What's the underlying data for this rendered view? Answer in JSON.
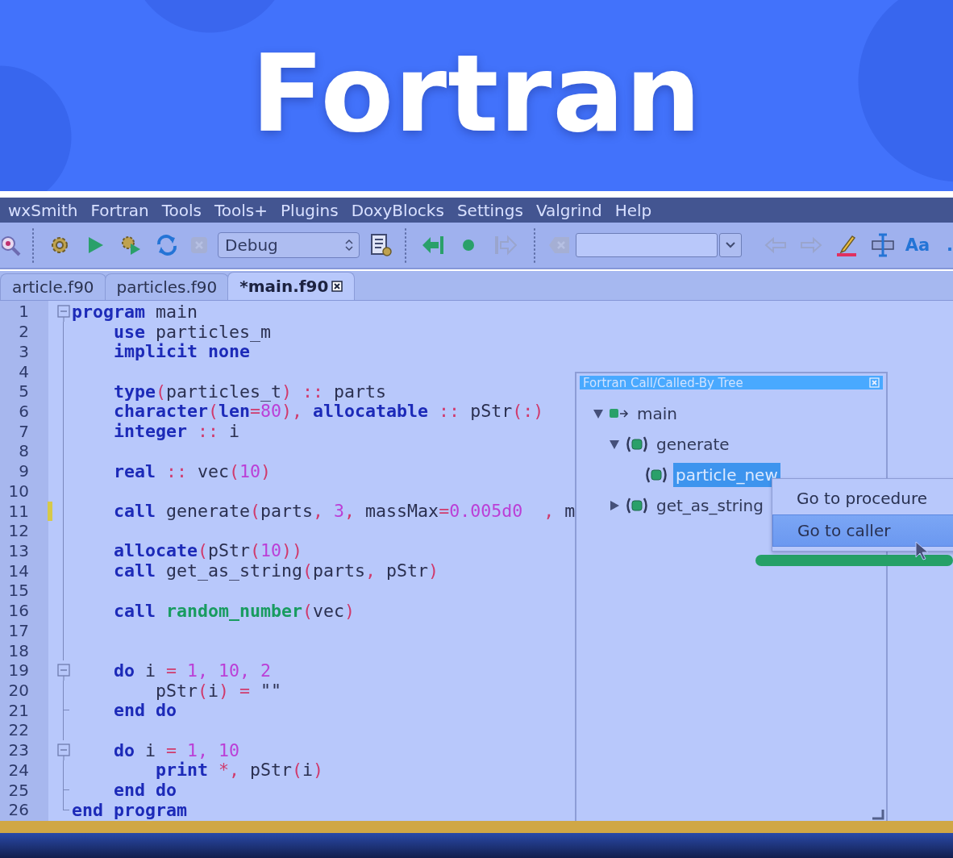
{
  "banner": {
    "title": "Fortran"
  },
  "menu": [
    {
      "label": "wxSmith"
    },
    {
      "label": "Fortran"
    },
    {
      "label": "Tools"
    },
    {
      "label": "Tools+"
    },
    {
      "label": "Plugins"
    },
    {
      "label": "DoxyBlocks"
    },
    {
      "label": "Settings"
    },
    {
      "label": "Valgrind"
    },
    {
      "label": "Help"
    }
  ],
  "toolbar": [
    {
      "kind": "find",
      "disabled": false
    },
    {
      "kind": "grip"
    },
    {
      "kind": "build",
      "disabled": false
    },
    {
      "kind": "run",
      "disabled": false
    },
    {
      "kind": "buildrun",
      "disabled": false
    },
    {
      "kind": "rebuild",
      "disabled": false
    },
    {
      "kind": "abort",
      "disabled": true
    },
    {
      "kind": "select",
      "value": "Debug"
    },
    {
      "kind": "targets",
      "disabled": false
    },
    {
      "kind": "grip"
    },
    {
      "kind": "stepin",
      "disabled": false
    },
    {
      "kind": "breakpoint",
      "disabled": false
    },
    {
      "kind": "stepout",
      "disabled": true
    },
    {
      "kind": "grip"
    },
    {
      "kind": "clear",
      "disabled": true
    },
    {
      "kind": "combo"
    },
    {
      "kind": "back",
      "disabled": true
    },
    {
      "kind": "forward",
      "disabled": true
    },
    {
      "kind": "highlight",
      "disabled": false
    },
    {
      "kind": "ruler",
      "disabled": false
    },
    {
      "kind": "text",
      "label": "Aa",
      "disabled": false
    },
    {
      "kind": "text",
      "label": ".",
      "disabled": false
    }
  ],
  "tabs": [
    {
      "label": "article.f90",
      "selected": false
    },
    {
      "label": "particles.f90",
      "selected": false
    },
    {
      "label": "*main.f90",
      "selected": true
    }
  ],
  "editor": {
    "lines": [
      {
        "number": "1",
        "kind": "fold-start",
        "changed": false,
        "tokens": [
          {
            "kind": "kw",
            "t": "program"
          },
          {
            "kind": "id",
            "t": " main"
          }
        ]
      },
      {
        "number": "2",
        "kind": "fold-line",
        "changed": false,
        "tokens": [
          {
            "kind": "kw",
            "t": "    use"
          },
          {
            "kind": "id",
            "t": " particles_m"
          }
        ]
      },
      {
        "number": "3",
        "kind": "fold-line",
        "changed": false,
        "tokens": [
          {
            "kind": "kw",
            "t": "    implicit none"
          }
        ]
      },
      {
        "number": "4",
        "kind": "fold-line",
        "changed": false
      },
      {
        "number": "5",
        "kind": "fold-line",
        "changed": false,
        "tokens": [
          {
            "kind": "kw",
            "t": "    type"
          },
          {
            "kind": "op",
            "t": "("
          },
          {
            "kind": "id",
            "t": "particles_t"
          },
          {
            "kind": "op",
            "t": ") ::"
          },
          {
            "kind": "id",
            "t": " parts"
          }
        ]
      },
      {
        "number": "6",
        "kind": "fold-line",
        "changed": false,
        "tokens": [
          {
            "kind": "kw",
            "t": "    character"
          },
          {
            "kind": "op",
            "t": "("
          },
          {
            "kind": "kw",
            "t": "len"
          },
          {
            "kind": "op",
            "t": "="
          },
          {
            "kind": "num",
            "t": "80"
          },
          {
            "kind": "op",
            "t": "), "
          },
          {
            "kind": "kw",
            "t": "allocatable"
          },
          {
            "kind": "op",
            "t": " ::"
          },
          {
            "kind": "id",
            "t": " pStr"
          },
          {
            "kind": "op",
            "t": "(:)"
          }
        ]
      },
      {
        "number": "7",
        "kind": "fold-line",
        "changed": false,
        "tokens": [
          {
            "kind": "kw",
            "t": "    integer"
          },
          {
            "kind": "op",
            "t": " ::"
          },
          {
            "kind": "id",
            "t": " i"
          }
        ]
      },
      {
        "number": "8",
        "kind": "fold-line",
        "changed": false
      },
      {
        "number": "9",
        "kind": "fold-line",
        "changed": false,
        "tokens": [
          {
            "kind": "kw",
            "t": "    real"
          },
          {
            "kind": "op",
            "t": " ::"
          },
          {
            "kind": "id",
            "t": " vec"
          },
          {
            "kind": "op",
            "t": "("
          },
          {
            "kind": "num",
            "t": "10"
          },
          {
            "kind": "op",
            "t": ")"
          }
        ]
      },
      {
        "number": "10",
        "kind": "fold-line",
        "changed": false
      },
      {
        "number": "11",
        "kind": "fold-line",
        "changed": true,
        "tokens": [
          {
            "kind": "kw",
            "t": "    call"
          },
          {
            "kind": "id",
            "t": " generate"
          },
          {
            "kind": "op",
            "t": "("
          },
          {
            "kind": "id",
            "t": "parts"
          },
          {
            "kind": "op",
            "t": ", "
          },
          {
            "kind": "num",
            "t": "3"
          },
          {
            "kind": "op",
            "t": ", "
          },
          {
            "kind": "id",
            "t": "massMax"
          },
          {
            "kind": "op",
            "t": "="
          },
          {
            "kind": "num",
            "t": "0.005d0"
          },
          {
            "kind": "op",
            "t": "  , "
          },
          {
            "kind": "id",
            "t": "m"
          }
        ]
      },
      {
        "number": "12",
        "kind": "fold-line",
        "changed": false
      },
      {
        "number": "13",
        "kind": "fold-line",
        "changed": false,
        "tokens": [
          {
            "kind": "kw",
            "t": "    allocate"
          },
          {
            "kind": "op",
            "t": "("
          },
          {
            "kind": "id",
            "t": "pStr"
          },
          {
            "kind": "op",
            "t": "("
          },
          {
            "kind": "num",
            "t": "10"
          },
          {
            "kind": "op",
            "t": "))"
          }
        ]
      },
      {
        "number": "14",
        "kind": "fold-line",
        "changed": false,
        "tokens": [
          {
            "kind": "kw",
            "t": "    call"
          },
          {
            "kind": "id",
            "t": " get_as_string"
          },
          {
            "kind": "op",
            "t": "("
          },
          {
            "kind": "id",
            "t": "parts"
          },
          {
            "kind": "op",
            "t": ", "
          },
          {
            "kind": "id",
            "t": "pStr"
          },
          {
            "kind": "op",
            "t": ")"
          }
        ]
      },
      {
        "number": "15",
        "kind": "fold-line",
        "changed": false
      },
      {
        "number": "16",
        "kind": "fold-line",
        "changed": false,
        "tokens": [
          {
            "kind": "kw",
            "t": "    call "
          },
          {
            "kind": "fn",
            "t": "random_number"
          },
          {
            "kind": "op",
            "t": "("
          },
          {
            "kind": "id",
            "t": "vec"
          },
          {
            "kind": "op",
            "t": ")"
          }
        ]
      },
      {
        "number": "17",
        "kind": "fold-line",
        "changed": false
      },
      {
        "number": "18",
        "kind": "fold-line",
        "changed": false
      },
      {
        "number": "19",
        "kind": "fold-start",
        "changed": false,
        "tokens": [
          {
            "kind": "kw",
            "t": "    do"
          },
          {
            "kind": "id",
            "t": " i "
          },
          {
            "kind": "op",
            "t": "="
          },
          {
            "kind": "num",
            "t": " 1, 10, 2"
          }
        ]
      },
      {
        "number": "20",
        "kind": "fold-line",
        "changed": false,
        "tokens": [
          {
            "kind": "id",
            "t": "        pStr"
          },
          {
            "kind": "op",
            "t": "("
          },
          {
            "kind": "id",
            "t": "i"
          },
          {
            "kind": "op",
            "t": ") ="
          },
          {
            "kind": "id",
            "t": " \"\""
          }
        ]
      },
      {
        "number": "21",
        "kind": "fold-tee",
        "changed": false,
        "tokens": [
          {
            "kind": "kw",
            "t": "    end do"
          }
        ]
      },
      {
        "number": "22",
        "kind": "fold-line",
        "changed": false
      },
      {
        "number": "23",
        "kind": "fold-start",
        "changed": false,
        "tokens": [
          {
            "kind": "kw",
            "t": "    do"
          },
          {
            "kind": "id",
            "t": " i "
          },
          {
            "kind": "op",
            "t": "="
          },
          {
            "kind": "num",
            "t": " 1, 10"
          }
        ]
      },
      {
        "number": "24",
        "kind": "fold-line",
        "changed": false,
        "tokens": [
          {
            "kind": "kw",
            "t": "        print"
          },
          {
            "kind": "op",
            "t": " *,"
          },
          {
            "kind": "id",
            "t": " pStr"
          },
          {
            "kind": "op",
            "t": "("
          },
          {
            "kind": "id",
            "t": "i"
          },
          {
            "kind": "op",
            "t": ")"
          }
        ]
      },
      {
        "number": "25",
        "kind": "fold-tee",
        "changed": false,
        "tokens": [
          {
            "kind": "kw",
            "t": "    end do"
          }
        ]
      },
      {
        "number": "26",
        "kind": "fold-end",
        "changed": false,
        "tokens": [
          {
            "kind": "kw",
            "t": "end program"
          }
        ]
      }
    ]
  },
  "call_tree": {
    "title": "Fortran Call/Called-By Tree",
    "tree": [
      {
        "label": "main",
        "kind": "program",
        "expanded": true,
        "selected": false,
        "children": [
          {
            "label": "generate",
            "kind": "procedure",
            "expanded": true,
            "selected": false,
            "children": [
              {
                "label": "particle_new",
                "kind": "procedure",
                "selected": true
              }
            ]
          },
          {
            "label": "get_as_string",
            "kind": "procedure",
            "expanded": false,
            "selected": false
          }
        ]
      }
    ]
  },
  "context_menu": {
    "items": [
      {
        "label": "Go to procedure",
        "selected": false
      },
      {
        "label": "Go to caller",
        "selected": true
      }
    ]
  }
}
